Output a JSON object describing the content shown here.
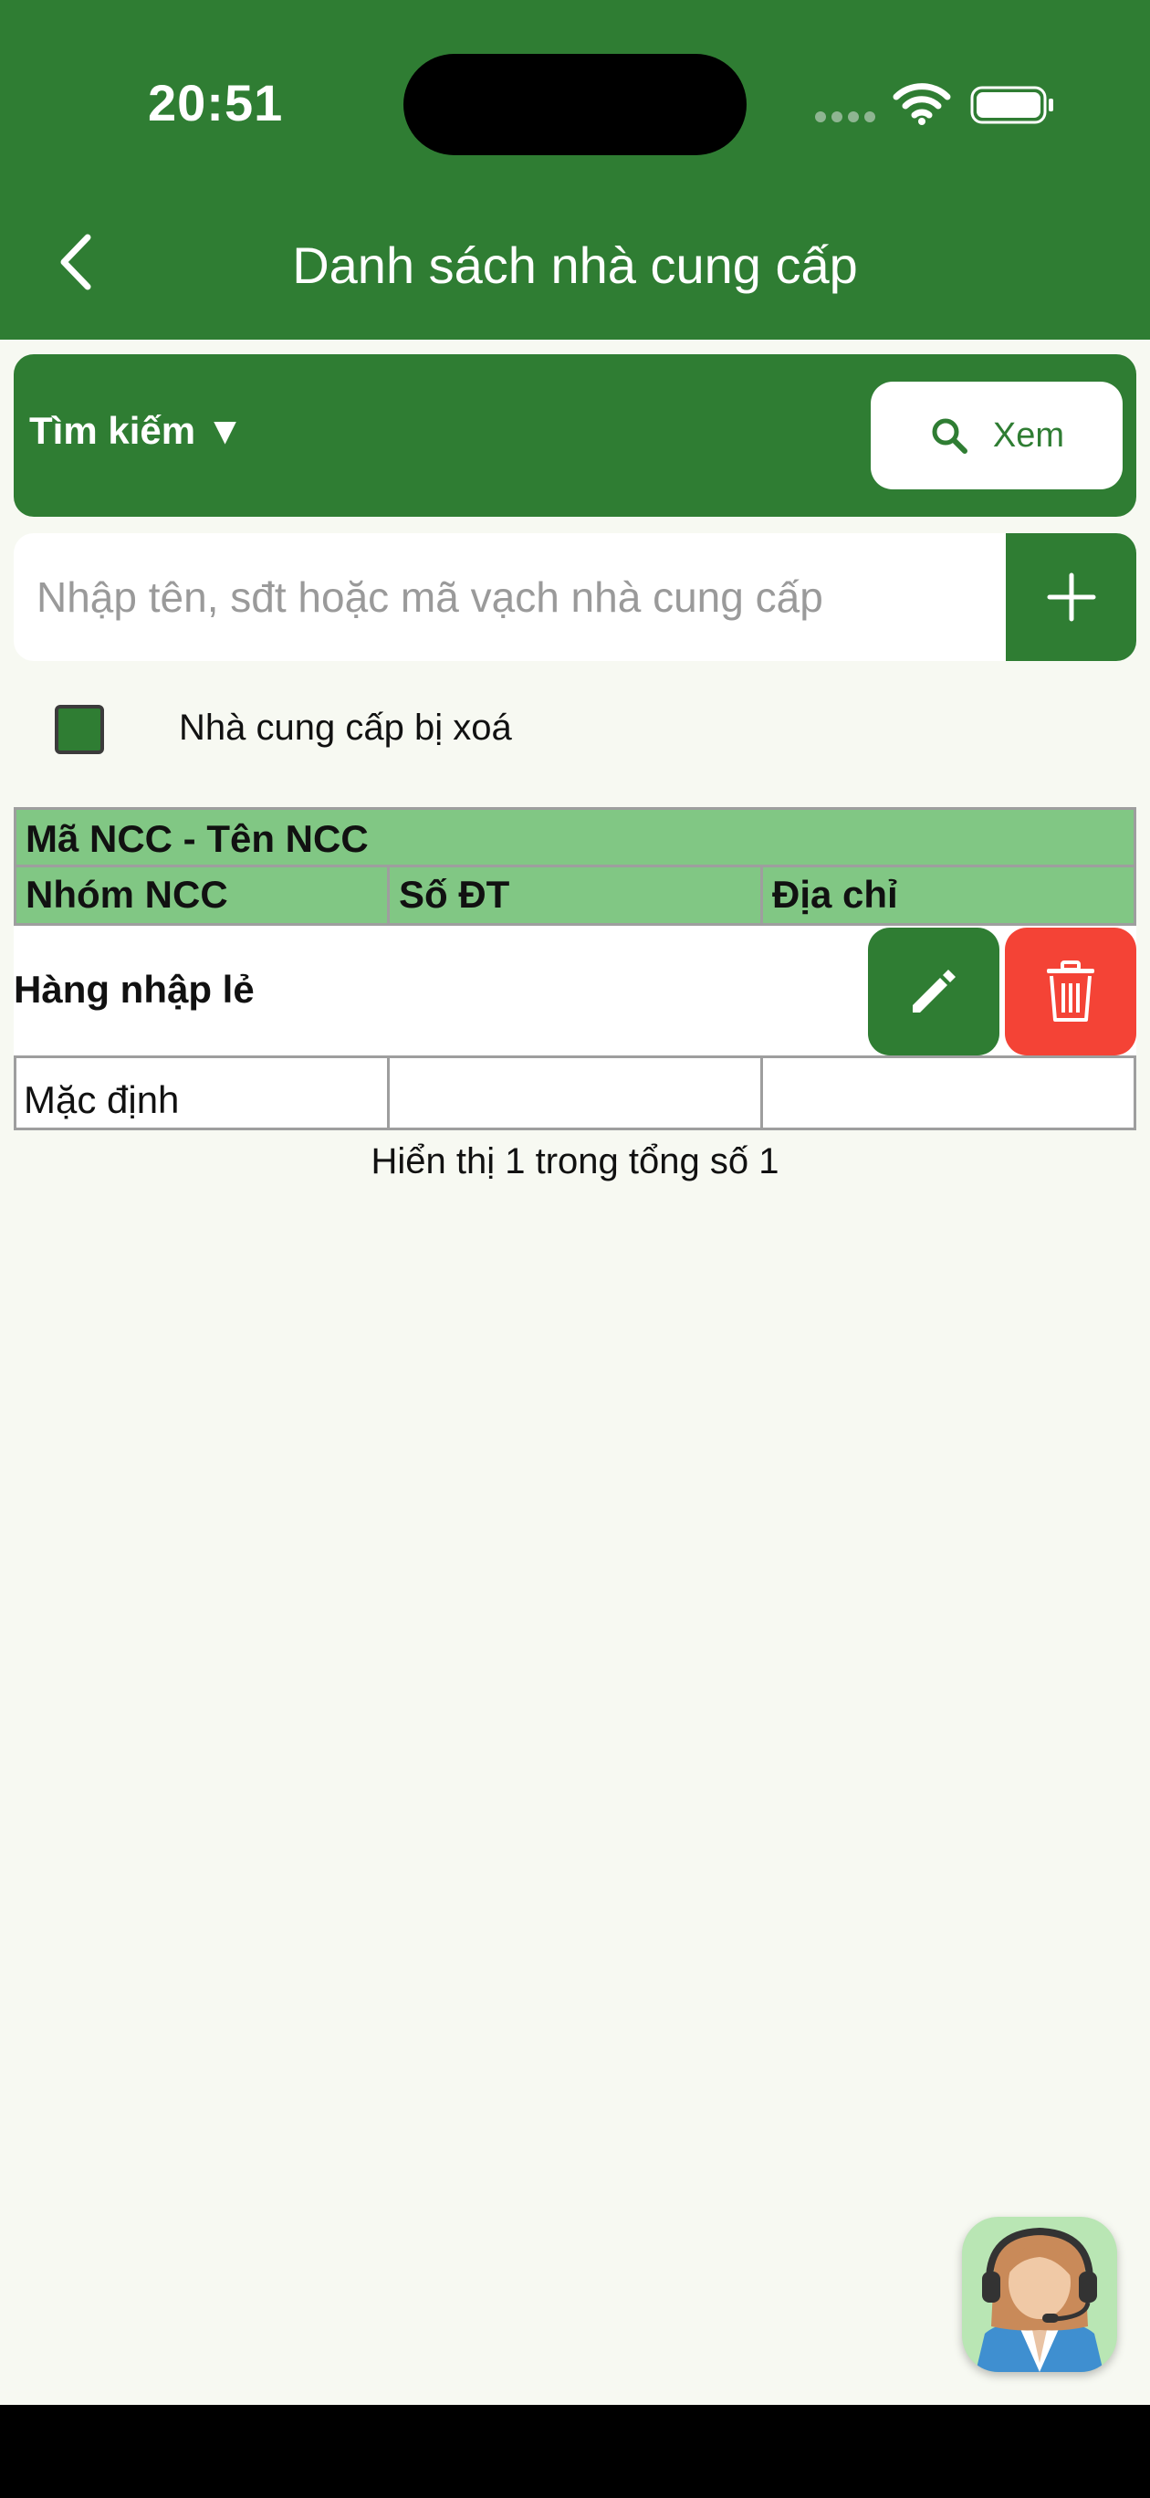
{
  "status_bar": {
    "time": "20:51"
  },
  "header": {
    "title": "Danh sách nhà cung cấp"
  },
  "search": {
    "label": "Tìm kiếm ▼",
    "view_button": "Xem",
    "placeholder": "Nhập tên, sđt hoặc mã vạch nhà cung cấp"
  },
  "filter": {
    "deleted_label": "Nhà cung cấp bị xoá",
    "deleted_checked": true
  },
  "table": {
    "header_row1": "Mã NCC - Tên NCC",
    "header_row2": [
      "Nhóm NCC",
      "Số ĐT",
      "Địa chỉ"
    ],
    "rows": [
      {
        "name": "Hàng nhập lẻ",
        "group": "Mặc định",
        "phone": "",
        "address": ""
      }
    ]
  },
  "pagination": {
    "summary": "Hiển thị 1 trong tổng số 1"
  },
  "colors": {
    "primary": "#2f7d33",
    "header_row": "#81c784",
    "danger": "#f44336",
    "background": "#f7f9f2"
  }
}
